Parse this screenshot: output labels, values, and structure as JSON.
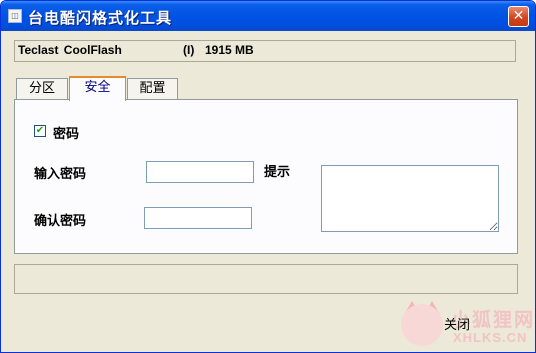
{
  "window": {
    "title": "台电酷闪格式化工具",
    "app_icon": "app-icon",
    "close_glyph": "✕",
    "accent_color": "#0054e3",
    "close_color": "#d5451f"
  },
  "device": {
    "name": "Teclast  CoolFlash",
    "drive": "(I)",
    "size": "1915 MB"
  },
  "tabs": [
    {
      "label": "分区",
      "active": false
    },
    {
      "label": "安全",
      "active": true
    },
    {
      "label": "配置",
      "active": false
    }
  ],
  "security": {
    "password_checkbox_label": "密码",
    "password_checked": true,
    "check_glyph": "✔",
    "enter_password_label": "输入密码",
    "enter_password_value": "",
    "confirm_password_label": "确认密码",
    "confirm_password_value": "",
    "hint_label": "提示",
    "hint_value": ""
  },
  "status_bar": {
    "text": ""
  },
  "footer": {
    "close_label": "关闭"
  },
  "watermark": {
    "line1": "小狐狸网",
    "line2": "XHLKS.CN"
  }
}
